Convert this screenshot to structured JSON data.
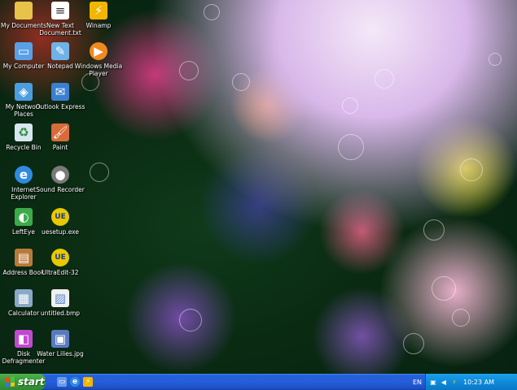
{
  "desktop": {
    "icons": [
      {
        "label": "My Documents",
        "icon": "folder-icon",
        "color": "#e8c34a"
      },
      {
        "label": "New Text Document.txt",
        "icon": "text-file-icon",
        "color": "#ffffff"
      },
      {
        "label": "Winamp",
        "icon": "winamp-icon",
        "color": "#f2b500"
      },
      {
        "label": "My Computer",
        "icon": "computer-icon",
        "color": "#5aa0e6"
      },
      {
        "label": "Notepad",
        "icon": "notepad-icon",
        "color": "#6fb2e8"
      },
      {
        "label": "Windows Media Player",
        "icon": "media-player-icon",
        "color": "#f08a1e"
      },
      {
        "label": "My Network Places",
        "icon": "network-icon",
        "color": "#4c9de0"
      },
      {
        "label": "Outlook Express",
        "icon": "outlook-icon",
        "color": "#3a7fd0"
      },
      {
        "label": "Recycle Bin",
        "icon": "recycle-bin-icon",
        "color": "#d8e6f0"
      },
      {
        "label": "Paint",
        "icon": "paint-icon",
        "color": "#d86b3a"
      },
      {
        "label": "Internet Explorer",
        "icon": "internet-explorer-icon",
        "color": "#2f8ae0"
      },
      {
        "label": "Sound Recorder",
        "icon": "sound-recorder-icon",
        "color": "#7a7a7a"
      },
      {
        "label": "LeftEye",
        "icon": "lefteye-icon",
        "color": "#3caa4a"
      },
      {
        "label": "uesetup.exe",
        "icon": "uesetup-icon",
        "color": "#e8c800"
      },
      {
        "label": "Address Book",
        "icon": "address-book-icon",
        "color": "#b87a3a"
      },
      {
        "label": "UltraEdit-32",
        "icon": "ultraedit-icon",
        "color": "#e8c800"
      },
      {
        "label": "Calculator",
        "icon": "calculator-icon",
        "color": "#8aa8c8"
      },
      {
        "label": "untitled.bmp",
        "icon": "bitmap-file-icon",
        "color": "#f0f0f0"
      },
      {
        "label": "Disk Defragmenter",
        "icon": "defragmenter-icon",
        "color": "#c04ad0"
      },
      {
        "label": "Water Lilies.jpg",
        "icon": "image-file-icon",
        "color": "#5a7ac0"
      }
    ]
  },
  "taskbar": {
    "start_label": "start",
    "quick_launch": [
      {
        "icon": "show-desktop-icon",
        "color": "#6a9ae8"
      },
      {
        "icon": "internet-explorer-icon",
        "color": "#2f8ae0"
      },
      {
        "icon": "winamp-icon",
        "color": "#f2b500"
      }
    ],
    "language": "EN",
    "tray": [
      {
        "icon": "network-tray-icon"
      },
      {
        "icon": "volume-icon"
      },
      {
        "icon": "winamp-tray-icon"
      }
    ],
    "clock": "10:23 AM"
  }
}
